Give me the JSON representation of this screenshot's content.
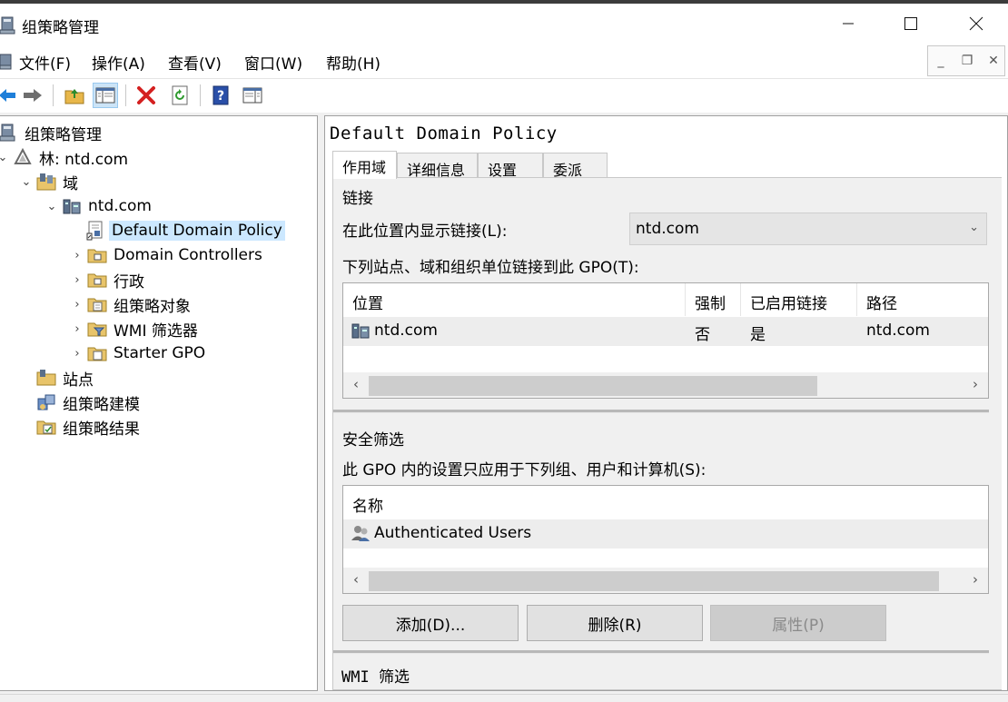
{
  "window": {
    "title": "组策略管理"
  },
  "menu": [
    "文件(F)",
    "操作(A)",
    "查看(V)",
    "窗口(W)",
    "帮助(H)"
  ],
  "tree": {
    "items": [
      {
        "label": "组策略管理",
        "icon": "gpm-icon"
      },
      {
        "label": "林: ntd.com",
        "icon": "forest-icon"
      },
      {
        "label": "域",
        "icon": "domains-icon"
      },
      {
        "label": "ntd.com",
        "icon": "domain-icon"
      },
      {
        "label": "Default Domain Policy",
        "icon": "gpo-link-icon"
      },
      {
        "label": "Domain Controllers",
        "icon": "ou-folder-icon"
      },
      {
        "label": "行政",
        "icon": "ou-folder-icon"
      },
      {
        "label": "组策略对象",
        "icon": "gpo-folder-icon"
      },
      {
        "label": "WMI 筛选器",
        "icon": "wmi-folder-icon"
      },
      {
        "label": "Starter GPO",
        "icon": "starter-folder-icon"
      },
      {
        "label": "站点",
        "icon": "sites-icon"
      },
      {
        "label": "组策略建模",
        "icon": "modeling-icon"
      },
      {
        "label": "组策略结果",
        "icon": "results-icon"
      }
    ]
  },
  "detail": {
    "gpo_name": "Default Domain Policy",
    "tabs": [
      "作用域",
      "详细信息",
      "设置",
      "委派"
    ],
    "links_heading": "链接",
    "show_links_label": "在此位置内显示链接(L):",
    "location_value": "ntd.com",
    "linked_label": "下列站点、域和组织单位链接到此 GPO(T):",
    "links_table": {
      "columns": [
        "位置",
        "强制",
        "已启用链接",
        "路径"
      ],
      "rows": [
        {
          "location": "ntd.com",
          "enforced": "否",
          "enabled": "是",
          "path": "ntd.com"
        }
      ]
    },
    "security_heading": "安全筛选",
    "security_label": "此 GPO 内的设置只应用于下列组、用户和计算机(S):",
    "security_table": {
      "columns": [
        "名称"
      ],
      "rows": [
        {
          "name": "Authenticated Users"
        }
      ]
    },
    "buttons": {
      "add": "添加(D)...",
      "remove": "删除(R)",
      "properties": "属性(P)"
    },
    "wmi_heading": "WMI 筛选"
  }
}
